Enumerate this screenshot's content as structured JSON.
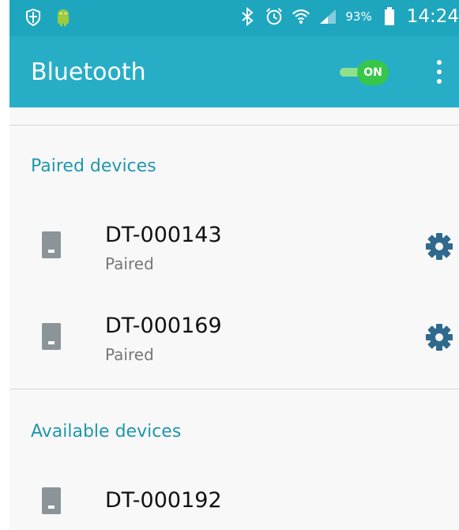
{
  "status_bar": {
    "battery_percent": "93%",
    "time": "14:24",
    "icons": [
      "shield-icon",
      "android-icon",
      "bluetooth-icon",
      "alarm-icon",
      "wifi-icon",
      "signal-icon",
      "battery-icon"
    ]
  },
  "app_bar": {
    "title": "Bluetooth",
    "toggle_label": "ON",
    "toggle_state": true
  },
  "paired_section": {
    "title": "Paired devices",
    "devices": [
      {
        "name": "DT-000143",
        "status": "Paired"
      },
      {
        "name": "DT-000169",
        "status": "Paired"
      }
    ]
  },
  "available_section": {
    "title": "Available devices",
    "devices": [
      {
        "name": "DT-000192"
      }
    ]
  },
  "colors": {
    "status_bar": "#1fa6bf",
    "app_bar": "#27aec6",
    "accent": "#1f97ad",
    "toggle_on": "#37c64a",
    "gear": "#2f6a8e"
  }
}
